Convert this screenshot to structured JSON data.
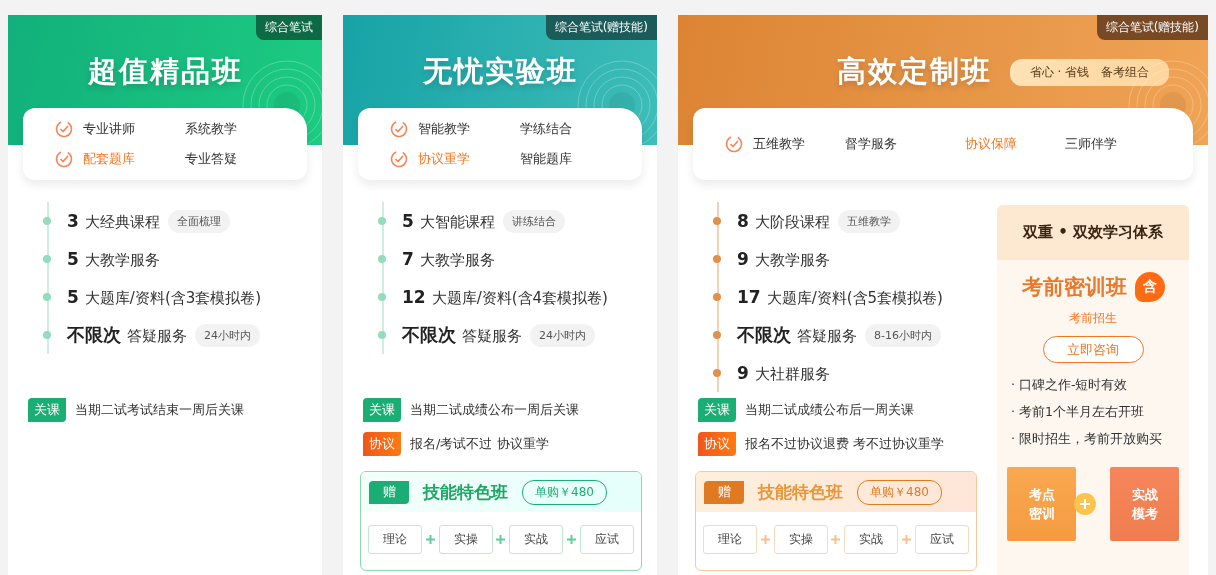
{
  "cards": [
    {
      "kind": "green",
      "tag": "综合笔试",
      "title": "超值精品班",
      "features": [
        {
          "label": "专业讲师",
          "checked": true,
          "highlighted": false
        },
        {
          "label": "系统教学",
          "checked": false,
          "highlighted": false
        },
        {
          "label": "配套题库",
          "checked": true,
          "highlighted": true
        },
        {
          "label": "专业答疑",
          "checked": false,
          "highlighted": false
        }
      ],
      "stats": [
        {
          "num": "3",
          "text": "大经典课程",
          "chip": "全面梳理"
        },
        {
          "num": "5",
          "text": "大教学服务"
        },
        {
          "num": "5",
          "text": "大题库/资料(含3套模拟卷)"
        },
        {
          "num": "不限次",
          "text": "答疑服务",
          "chip": "24小时内"
        }
      ],
      "notes": [
        {
          "kind": "close",
          "label": "关课",
          "text": "当期二试考试结束一周后关课"
        }
      ]
    },
    {
      "kind": "teal",
      "tag": "综合笔试(赠技能)",
      "title": "无忧实验班",
      "features": [
        {
          "label": "智能教学",
          "checked": true,
          "highlighted": false
        },
        {
          "label": "学练结合",
          "checked": false,
          "highlighted": false
        },
        {
          "label": "协议重学",
          "checked": true,
          "highlighted": true
        },
        {
          "label": "智能题库",
          "checked": false,
          "highlighted": false
        }
      ],
      "stats": [
        {
          "num": "5",
          "text": "大智能课程",
          "chip": "讲练结合"
        },
        {
          "num": "7",
          "text": "大教学服务"
        },
        {
          "num": "12",
          "text": "大题库/资料(含4套模拟卷)"
        },
        {
          "num": "不限次",
          "text": "答疑服务",
          "chip": "24小时内"
        }
      ],
      "notes": [
        {
          "kind": "close",
          "label": "关课",
          "text": "当期二试成绩公布一周后关课"
        },
        {
          "kind": "agreement",
          "label": "协议",
          "text": "报名/考试不过 协议重学"
        }
      ],
      "gift": {
        "badge": "赠",
        "title": "技能特色班",
        "price": "单购￥480",
        "steps": [
          "理论",
          "实操",
          "实战",
          "应试"
        ]
      }
    },
    {
      "kind": "orange",
      "tag": "综合笔试(赠技能)",
      "title": "高效定制班",
      "slogan": "省心 · 省钱　备考组合",
      "features": [
        {
          "label": "五维教学",
          "checked": true,
          "highlighted": false
        },
        {
          "label": "督学服务",
          "checked": false,
          "highlighted": false
        },
        {
          "label": "协议保障",
          "checked": false,
          "highlighted": true
        },
        {
          "label": "三师伴学",
          "checked": false,
          "highlighted": false
        }
      ],
      "stats": [
        {
          "num": "8",
          "text": "大阶段课程",
          "chip": "五维教学"
        },
        {
          "num": "9",
          "text": "大教学服务"
        },
        {
          "num": "17",
          "text": "大题库/资料(含5套模拟卷)"
        },
        {
          "num": "不限次",
          "text": "答疑服务",
          "chip": "8-16小时内"
        },
        {
          "num": "9",
          "text": "大社群服务"
        }
      ],
      "notes": [
        {
          "kind": "close",
          "label": "关课",
          "text": "当期二试成绩公布后一周关课"
        },
        {
          "kind": "agreement",
          "label": "协议",
          "text": "报名不过协议退费 考不过协议重学"
        }
      ],
      "gift": {
        "badge": "赠",
        "title": "技能特色班",
        "price": "单购￥480",
        "steps": [
          "理论",
          "实操",
          "实战",
          "应试"
        ]
      },
      "side": {
        "heading": "双重 • 双效学习体系",
        "name": "考前密训班",
        "name_badge": "含",
        "subtitle": "考前招生",
        "button": "立即咨询",
        "bullets": [
          "· 口碑之作-短时有效",
          "· 考前1个半月左右开班",
          "· 限时招生，考前开放购买"
        ],
        "tiles": [
          "考点密训",
          "实战模考"
        ]
      }
    }
  ]
}
